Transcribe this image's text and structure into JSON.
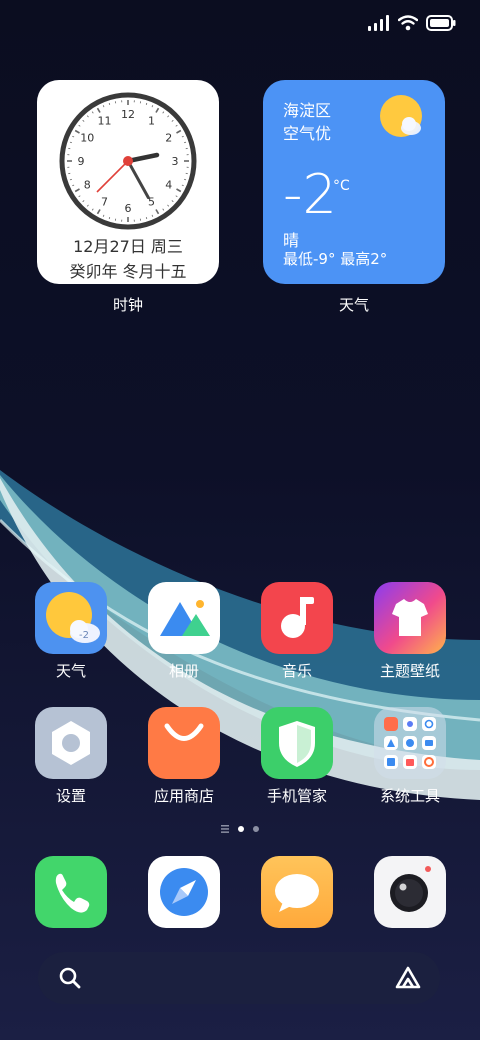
{
  "status_bar": {
    "signal_icon": "signal-icon",
    "wifi_icon": "wifi-icon",
    "battery_icon": "battery-icon"
  },
  "widgets": {
    "clock": {
      "caption": "时钟",
      "date": "12月27日 周三",
      "lunar": "癸卯年 冬月十五",
      "dial_numbers": [
        "12",
        "1",
        "2",
        "3",
        "4",
        "5",
        "6",
        "7",
        "8",
        "9",
        "10",
        "11"
      ]
    },
    "weather": {
      "caption": "天气",
      "location": "海淀区",
      "air_quality": "空气优",
      "temperature": "-2",
      "unit": "°C",
      "condition": "晴",
      "range": "最低-9° 最高2°"
    }
  },
  "apps": [
    {
      "label": "天气",
      "icon": "weather-app-icon",
      "badge": "-2"
    },
    {
      "label": "相册",
      "icon": "gallery-app-icon"
    },
    {
      "label": "音乐",
      "icon": "music-app-icon"
    },
    {
      "label": "主题壁纸",
      "icon": "themes-app-icon"
    },
    {
      "label": "设置",
      "icon": "settings-app-icon"
    },
    {
      "label": "应用商店",
      "icon": "app-store-icon"
    },
    {
      "label": "手机管家",
      "icon": "phone-manager-icon"
    },
    {
      "label": "系统工具",
      "icon": "system-tools-folder-icon"
    }
  ],
  "page_indicator": {
    "pages": 3,
    "current": 2
  },
  "dock": [
    {
      "icon": "phone-icon"
    },
    {
      "icon": "browser-icon"
    },
    {
      "icon": "messages-icon"
    },
    {
      "icon": "camera-icon"
    }
  ],
  "search": {
    "search_icon": "search-icon",
    "assistant_icon": "assistant-icon"
  },
  "colors": {
    "weather_widget": "#4c93f5",
    "wallpaper_dark": "#0c0f24",
    "wave_blue": "#5aa9c4"
  }
}
